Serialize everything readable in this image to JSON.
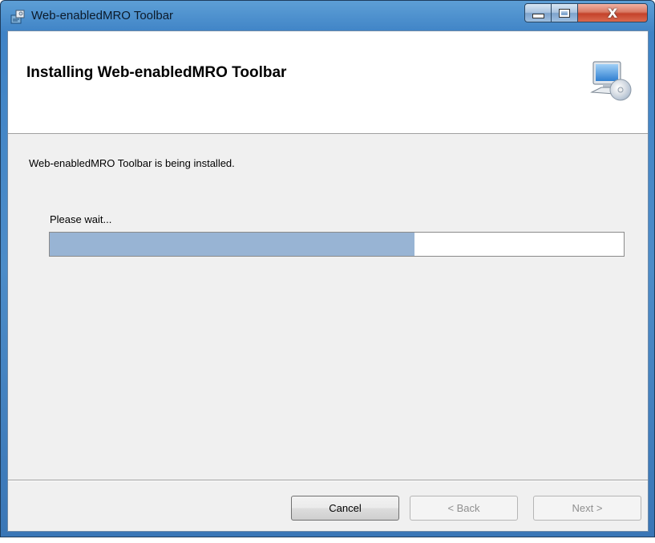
{
  "window": {
    "title": "Web-enabledMRO Toolbar",
    "close_glyph": "X"
  },
  "header": {
    "title": "Installing Web-enabledMRO Toolbar",
    "icon": "computer-cd-setup-icon"
  },
  "body": {
    "status_text": "Web-enabledMRO Toolbar is being installed.",
    "wait_label": "Please wait...",
    "progress_fraction": 0.636
  },
  "footer": {
    "cancel_label": "Cancel",
    "back_label": "< Back",
    "next_label": "Next >"
  },
  "colors": {
    "progress_fill": "#98b4d4",
    "titlebar": "#4d8cc8",
    "close_button": "#c4432b"
  }
}
